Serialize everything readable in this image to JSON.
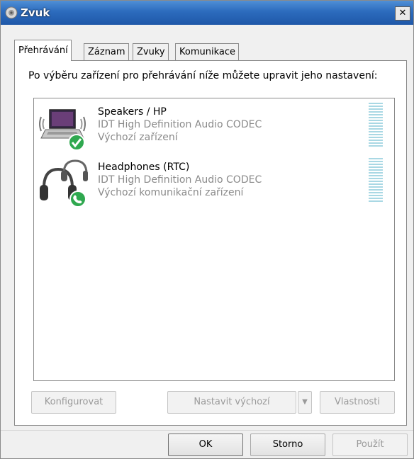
{
  "window": {
    "title": "Zvuk",
    "close_glyph": "✕"
  },
  "tabs": [
    {
      "label": "Přehrávání",
      "active": true
    },
    {
      "label": "Záznam",
      "active": false
    },
    {
      "label": "Zvuky",
      "active": false
    },
    {
      "label": "Komunikace",
      "active": false
    }
  ],
  "panel": {
    "instruction": "Po výběru zařízení pro přehrávání níže můžete upravit jeho nastavení:"
  },
  "devices": [
    {
      "name": "Speakers / HP",
      "driver": "IDT High Definition Audio CODEC",
      "status": "Výchozí zařízení",
      "icon": "speakers-laptop-icon",
      "badge": "default-check-icon"
    },
    {
      "name": "Headphones (RTC)",
      "driver": "IDT High Definition Audio CODEC",
      "status": "Výchozí komunikační zařízení",
      "icon": "headphones-icon",
      "badge": "default-communication-phone-icon"
    }
  ],
  "buttons": {
    "configure": "Konfigurovat",
    "set_default": "Nastavit výchozí",
    "properties": "Vlastnosti",
    "ok": "OK",
    "cancel": "Storno",
    "apply": "Použít"
  },
  "colors": {
    "title_bar": "#2c6bbd",
    "level_meter": "#a9d8e4",
    "check_badge": "#2fa84f"
  }
}
